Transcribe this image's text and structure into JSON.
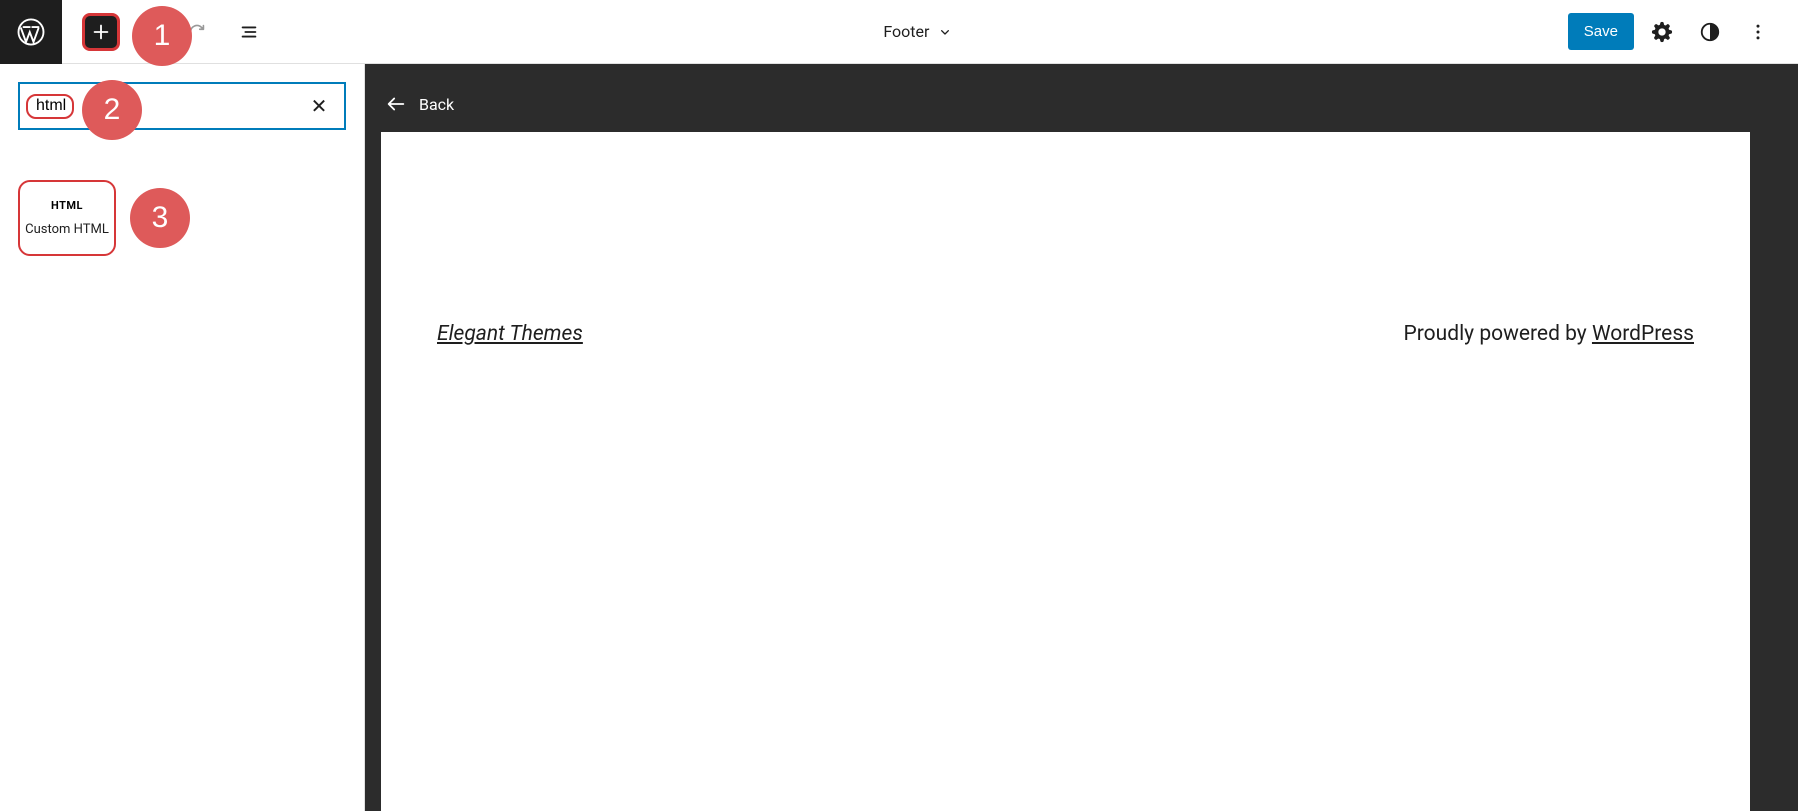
{
  "topbar": {
    "center_title": "Footer",
    "save_label": "Save"
  },
  "sidebar": {
    "search_value": "html",
    "block_item_icon": "HTML",
    "block_item_label": "Custom HTML"
  },
  "canvas": {
    "back_label": "Back",
    "footer_left": "Elegant Themes",
    "footer_right_text": "Proudly powered by ",
    "footer_right_link": "WordPress"
  },
  "annotations": {
    "n1": "1",
    "n2": "2",
    "n3": "3"
  }
}
